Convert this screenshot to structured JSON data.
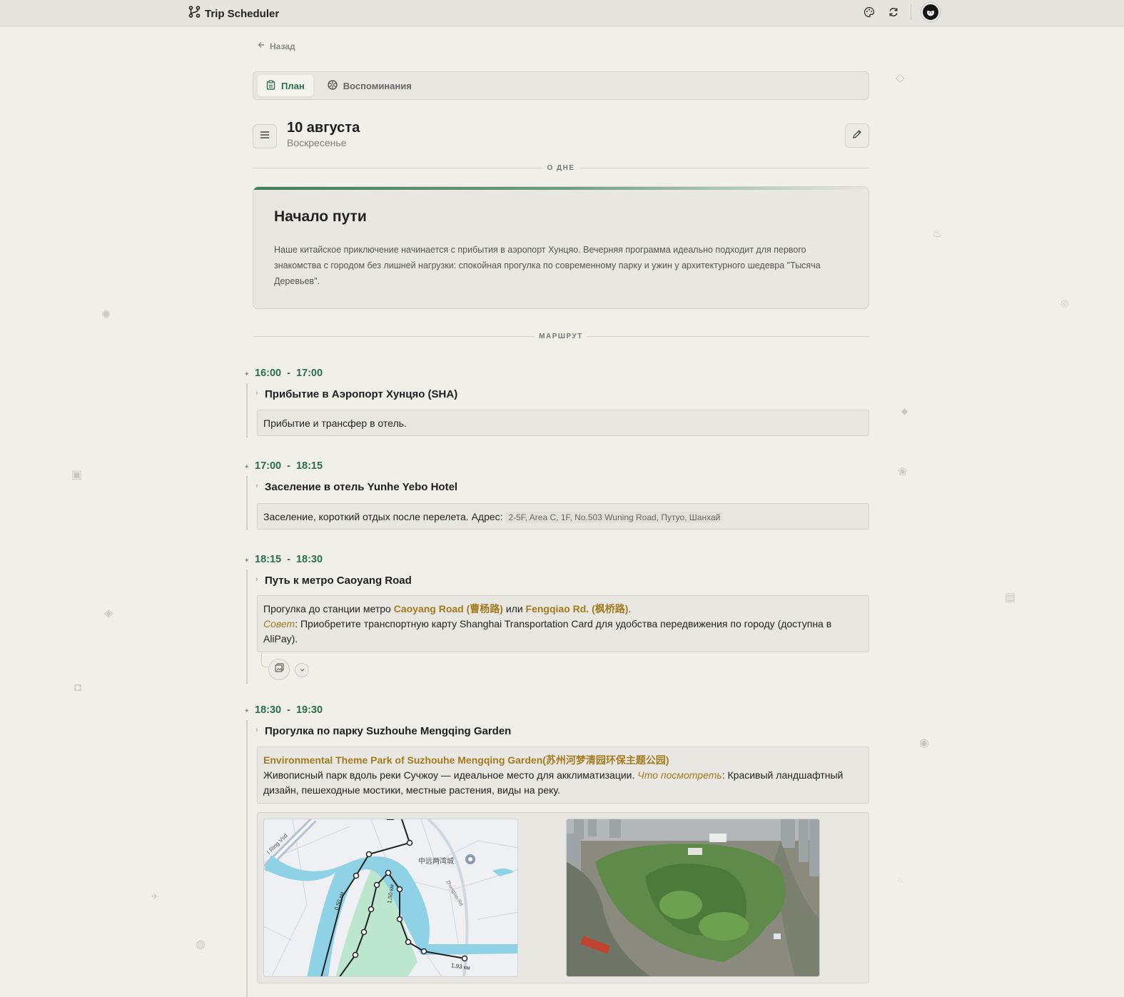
{
  "app": {
    "title": "Trip Scheduler",
    "logo_icon": "route-icon"
  },
  "topbar": {
    "theme_icon": "palette-icon",
    "sync_icon": "refresh-icon",
    "avatar_icon": "avatar"
  },
  "nav": {
    "back_label": "Назад"
  },
  "tabs": [
    {
      "label": "План",
      "icon": "clipboard-icon",
      "active": true
    },
    {
      "label": "Воспоминания",
      "icon": "aperture-icon",
      "active": false
    }
  ],
  "day": {
    "title": "10 августа",
    "weekday": "Воскресенье"
  },
  "sections": {
    "about": "О ДНЕ",
    "route": "МАРШРУТ"
  },
  "about": {
    "title": "Начало пути",
    "text": "Наше китайское приключение начинается с прибытия в аэропорт Хунцяо. Вечерняя программа идеально подходит для первого знакомства с городом без лишней нагрузки: спокойная прогулка по современному парку и ужин у архитектурного шедевра \"Тысяча Деревьев\"."
  },
  "events": [
    {
      "start": "16:00",
      "sep": "-",
      "end": "17:00",
      "title": "Прибытие в Аэропорт Хунцяо (SHA)",
      "text": "Прибытие и трансфер в отель."
    },
    {
      "start": "17:00",
      "sep": "-",
      "end": "18:15",
      "title": "Заселение в отель Yunhe Yebo Hotel",
      "text": "Заселение, короткий отдых после перелета. Адрес:",
      "address": "2-5F, Area C, 1F, No.503 Wuning Road, Путуо, Шанхай"
    },
    {
      "start": "18:15",
      "sep": "-",
      "end": "18:30",
      "title": "Путь к метро Caoyang Road",
      "text_a": "Прогулка до станции метро ",
      "link_a": "Caoyang Road (曹杨路)",
      "text_b": " или ",
      "link_b": "Fengqiao Rd. (枫桥路)",
      "text_c": ".",
      "tip_label": "Совет",
      "tip_text": ": Приобретите транспортную карту Shanghai Transportation Card для удобства передвижения по городу (доступна в AliPay)."
    },
    {
      "start": "18:30",
      "sep": "-",
      "end": "19:30",
      "title": "Прогулка по парку Suzhouhe Mengqing Garden",
      "link": "Environmental Theme Park of Suzhouhe Mengqing Garden(苏州河梦清园环保主题公园)",
      "text_a": "Живописный парк вдоль реки Сучжоу — идеальное место для акклиматизации. ",
      "see_label": "Что посмотреть",
      "text_b": ": Красивый ландшафтный дизайн, пешеходные мостики, местные растения, виды на реку."
    }
  ],
  "map": {
    "road_label": "I Ring Vsd",
    "place_label": "中远两湾城",
    "street_label": "Zhongtan Rd",
    "dist_1": "0,50 км",
    "dist_2": "1,50 км",
    "dist_3": "1,93 км"
  },
  "colors": {
    "accent": "#2b6e4a",
    "gold": "#a37b1f",
    "background": "#f0efe8"
  }
}
